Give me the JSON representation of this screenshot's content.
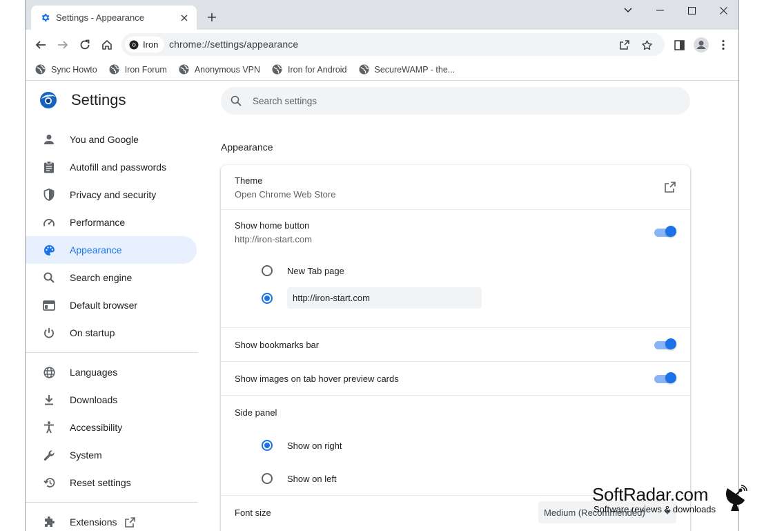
{
  "tab": {
    "title": "Settings - Appearance"
  },
  "omnibox": {
    "chip_label": "Iron",
    "url": "chrome://settings/appearance"
  },
  "bookmarks": [
    {
      "label": "Sync Howto"
    },
    {
      "label": "Iron Forum"
    },
    {
      "label": "Anonymous VPN"
    },
    {
      "label": "Iron for Android"
    },
    {
      "label": "SecureWAMP - the..."
    }
  ],
  "settings": {
    "title": "Settings",
    "search_placeholder": "Search settings",
    "nav": [
      {
        "label": "You and Google",
        "icon": "person-icon"
      },
      {
        "label": "Autofill and passwords",
        "icon": "clipboard-icon"
      },
      {
        "label": "Privacy and security",
        "icon": "shield-icon"
      },
      {
        "label": "Performance",
        "icon": "speedometer-icon"
      },
      {
        "label": "Appearance",
        "icon": "palette-icon",
        "active": true
      },
      {
        "label": "Search engine",
        "icon": "search-icon"
      },
      {
        "label": "Default browser",
        "icon": "browser-icon"
      },
      {
        "label": "On startup",
        "icon": "power-icon"
      },
      {
        "label": "Languages",
        "icon": "globe-icon"
      },
      {
        "label": "Downloads",
        "icon": "download-icon"
      },
      {
        "label": "Accessibility",
        "icon": "accessibility-icon"
      },
      {
        "label": "System",
        "icon": "wrench-icon"
      },
      {
        "label": "Reset settings",
        "icon": "reset-icon"
      },
      {
        "label": "Extensions",
        "icon": "puzzle-icon"
      }
    ]
  },
  "appearance": {
    "section_title": "Appearance",
    "theme": {
      "label": "Theme",
      "sub": "Open Chrome Web Store"
    },
    "home_button": {
      "label": "Show home button",
      "sub": "http://iron-start.com",
      "enabled": true
    },
    "home_options": {
      "new_tab": "New Tab page",
      "custom_url": "http://iron-start.com",
      "selected": "custom_url"
    },
    "bookmarks_bar": {
      "label": "Show bookmarks bar",
      "enabled": true
    },
    "hover_cards": {
      "label": "Show images on tab hover preview cards",
      "enabled": true
    },
    "side_panel": {
      "label": "Side panel",
      "right": "Show on right",
      "left": "Show on left",
      "selected": "right"
    },
    "font_size": {
      "label": "Font size",
      "value": "Medium (Recommended)"
    }
  },
  "watermark": {
    "brand": "SoftRadar.com",
    "tagline": "Software reviews & downloads"
  },
  "colors": {
    "accent": "#1a73e8",
    "active_bg": "#e8f0fe",
    "toggle_track": "#8ab4f8",
    "tabstrip": "#dee1e6"
  }
}
